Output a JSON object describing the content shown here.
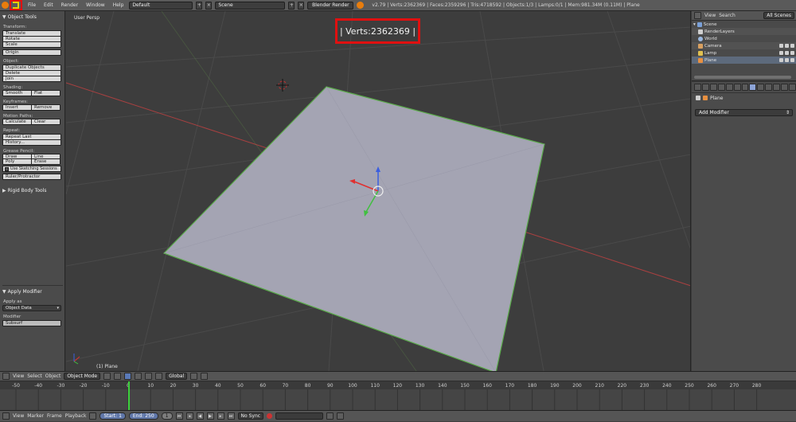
{
  "topbar": {
    "menus": [
      "File",
      "Edit",
      "Render",
      "Window",
      "Help"
    ],
    "screen_layout": "Default",
    "scene": "Scene",
    "render_engine": "Blender Render",
    "stats": "v2.79 | Verts:2362369 | Faces:2359296 | Tris:4718592 | Objects:1/3 | Lamps:0/1 | Mem:981.34M (0.11M) | Plane"
  },
  "toolshelf": {
    "panel_title": "Object Tools",
    "sections": {
      "transform": {
        "label": "Transform:",
        "buttons": [
          "Translate",
          "Rotate",
          "Scale"
        ],
        "extra": "Origin"
      },
      "object": {
        "label": "Object:",
        "buttons": [
          "Duplicate Objects",
          "Delete",
          "Join"
        ]
      },
      "shading": {
        "label": "Shading:",
        "smooth": "Smooth",
        "flat": "Flat"
      },
      "keyframes": {
        "label": "Keyframes:",
        "insert": "Insert",
        "remove": "Remove"
      },
      "motion_paths": {
        "label": "Motion Paths:",
        "calculate": "Calculate",
        "clear": "Clear"
      },
      "repeat": {
        "label": "Repeat:",
        "buttons": [
          "Repeat Last",
          "History..."
        ]
      },
      "grease_pencil": {
        "label": "Grease Pencil:",
        "draw": "Draw",
        "line": "Line",
        "poly": "Poly",
        "erase": "Erase",
        "use_sketching": "Use Sketching Sessions",
        "ruler": "Ruler/Protractor"
      }
    },
    "rigid_body_panel": "Rigid Body Tools",
    "operator_panel": {
      "title": "Apply Modifier",
      "apply_as_label": "Apply as",
      "apply_as_value": "Object Data",
      "modifier_label": "Modifier",
      "modifier_value": "Subsurf"
    }
  },
  "viewport": {
    "view_name": "User Persp",
    "object_label": "(1) Plane",
    "verts_callout": "| Verts:2362369 |"
  },
  "outliner": {
    "menus": [
      "View",
      "Search"
    ],
    "filter": "All Scenes",
    "items": [
      {
        "label": "Scene"
      },
      {
        "label": "RenderLayers"
      },
      {
        "label": "World"
      },
      {
        "label": "Camera"
      },
      {
        "label": "Lamp"
      },
      {
        "label": "Plane"
      }
    ]
  },
  "properties": {
    "object_name": "Plane",
    "add_modifier": "Add Modifier"
  },
  "timeline_header": {
    "menus": [
      "View",
      "Select",
      "Object"
    ],
    "mode": "Object Mode",
    "pivot_orientation": "Global"
  },
  "timeline": {
    "ticks": [
      "-50",
      "-40",
      "-30",
      "-20",
      "-10",
      "0",
      "10",
      "20",
      "30",
      "40",
      "50",
      "60",
      "70",
      "80",
      "90",
      "100",
      "110",
      "120",
      "130",
      "140",
      "150",
      "160",
      "170",
      "180",
      "190",
      "200",
      "210",
      "220",
      "230",
      "240",
      "250",
      "260",
      "270",
      "280"
    ],
    "current_frame": 0
  },
  "timeline_footer": {
    "menus": [
      "View",
      "Marker",
      "Frame",
      "Playback"
    ],
    "start": "Start: 1",
    "end": "End: 250",
    "frame": "1",
    "sync": "No Sync"
  },
  "colors": {
    "viewport_bg": "#3d3d3d",
    "plane_fill": "#a4a4b3",
    "plane_edge": "#5aaa4a",
    "x_axis": "#a84040",
    "y_axis": "#6aa84a",
    "callout": "#e01010"
  }
}
